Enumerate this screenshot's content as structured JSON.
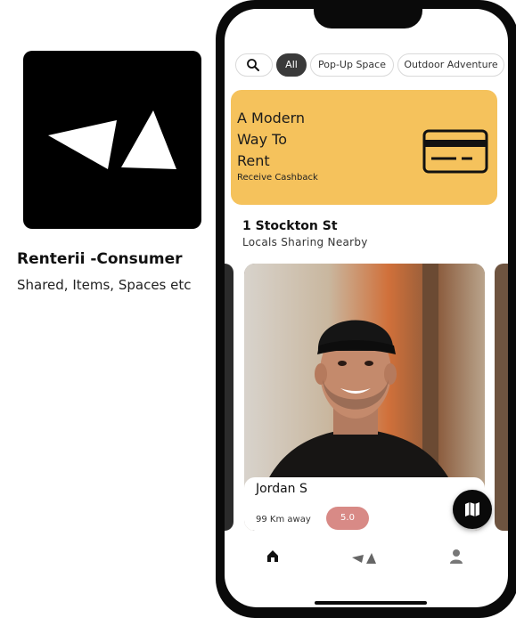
{
  "app": {
    "name": "Renterii -Consumer",
    "tagline": "Shared, Items, Spaces etc",
    "logo_icon": "renterii-logo-icon"
  },
  "filters": {
    "search_icon": "search-icon",
    "chips": [
      "All",
      "Pop-Up Space",
      "Outdoor Adventure"
    ],
    "active": "All"
  },
  "banner": {
    "title": "A Modern\nWay To\nRent",
    "subtitle": "Receive Cashback",
    "icon": "credit-card-icon",
    "color": "#f5c25c"
  },
  "location": {
    "address": "1 Stockton St",
    "subtitle": "Locals Sharing Nearby"
  },
  "profile": {
    "name": "Jordan S",
    "distance": "99 Km away",
    "rating": "5.0",
    "rating_color": "#d88a86"
  },
  "fab_icon": "map-icon",
  "tabs": [
    {
      "icon": "home-icon",
      "active": true
    },
    {
      "icon": "renterii-tab-icon",
      "active": false
    },
    {
      "icon": "profile-icon",
      "active": false
    }
  ]
}
